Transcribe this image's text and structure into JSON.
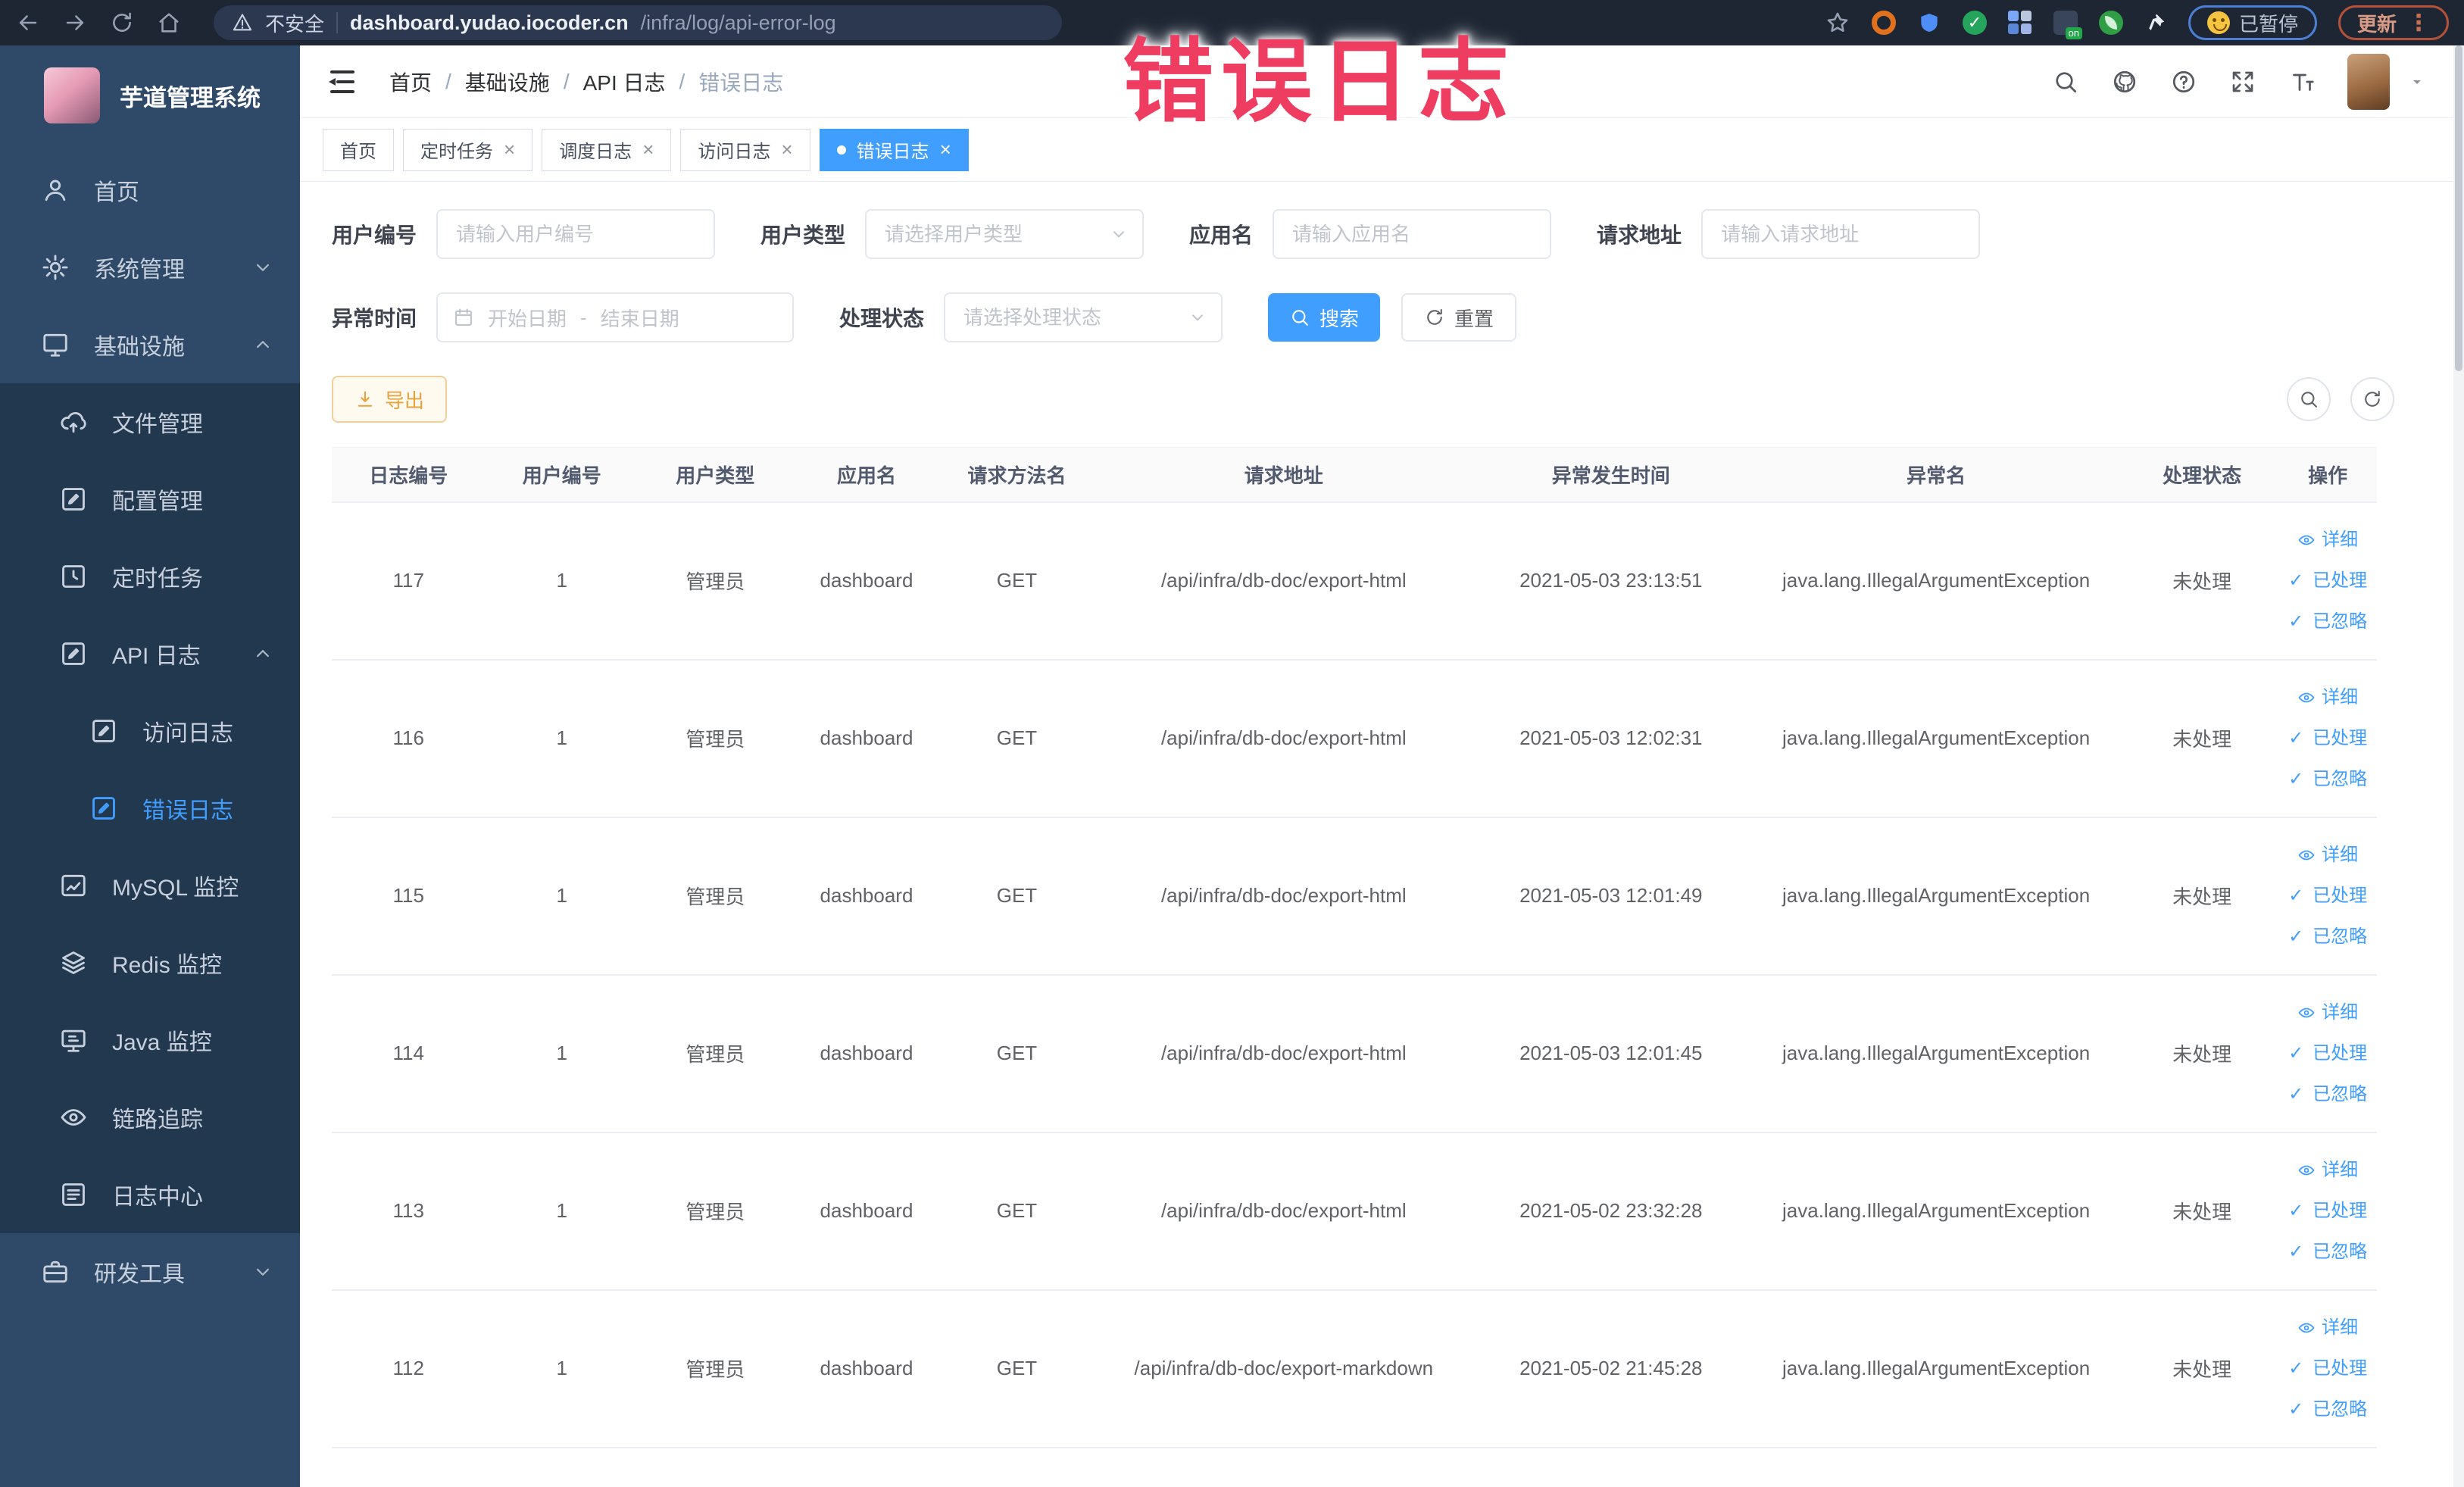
{
  "browser": {
    "security_label": "不安全",
    "url_domain": "dashboard.yudao.iocoder.cn",
    "url_path": "/infra/log/api-error-log",
    "paused_badge": "已暂停",
    "update_button": "更新"
  },
  "annotation": {
    "text": "错误日志",
    "color": "#ee3d60"
  },
  "sidebar": {
    "title": "芋道管理系统",
    "items": [
      {
        "label": "首页",
        "icon": "user-icon",
        "level": 1
      },
      {
        "label": "系统管理",
        "icon": "gear-icon",
        "level": 1,
        "arrow": "down"
      },
      {
        "label": "基础设施",
        "icon": "monitor-icon",
        "level": 1,
        "arrow": "up"
      },
      {
        "label": "文件管理",
        "icon": "cloud-upload-icon",
        "level": 2,
        "dark": true
      },
      {
        "label": "配置管理",
        "icon": "edit-icon",
        "level": 2,
        "dark": true
      },
      {
        "label": "定时任务",
        "icon": "schedule-icon",
        "level": 2,
        "dark": true
      },
      {
        "label": "API 日志",
        "icon": "log-icon",
        "level": 2,
        "dark": true,
        "arrow": "up"
      },
      {
        "label": "访问日志",
        "icon": "log-icon",
        "level": 3,
        "dark": true
      },
      {
        "label": "错误日志",
        "icon": "log-icon",
        "level": 3,
        "dark": true,
        "active": true
      },
      {
        "label": "MySQL 监控",
        "icon": "chart-icon",
        "level": 2,
        "dark": true
      },
      {
        "label": "Redis 监控",
        "icon": "layers-icon",
        "level": 2,
        "dark": true
      },
      {
        "label": "Java 监控",
        "icon": "java-icon",
        "level": 2,
        "dark": true
      },
      {
        "label": "链路追踪",
        "icon": "eye-icon",
        "level": 2,
        "dark": true
      },
      {
        "label": "日志中心",
        "icon": "doc-icon",
        "level": 2,
        "dark": true
      },
      {
        "label": "研发工具",
        "icon": "tools-icon",
        "level": 1,
        "arrow": "down"
      }
    ]
  },
  "breadcrumb": [
    "首页",
    "基础设施",
    "API 日志",
    "错误日志"
  ],
  "tabs": [
    {
      "label": "首页",
      "closable": false,
      "active": false
    },
    {
      "label": "定时任务",
      "closable": true,
      "active": false
    },
    {
      "label": "调度日志",
      "closable": true,
      "active": false
    },
    {
      "label": "访问日志",
      "closable": true,
      "active": false
    },
    {
      "label": "错误日志",
      "closable": true,
      "active": true
    }
  ],
  "filters": {
    "user_id": {
      "label": "用户编号",
      "placeholder": "请输入用户编号"
    },
    "user_type": {
      "label": "用户类型",
      "placeholder": "请选择用户类型"
    },
    "app_name": {
      "label": "应用名",
      "placeholder": "请输入应用名"
    },
    "request_url": {
      "label": "请求地址",
      "placeholder": "请输入请求地址"
    },
    "exception_time": {
      "label": "异常时间",
      "start_placeholder": "开始日期",
      "separator": "-",
      "end_placeholder": "结束日期"
    },
    "process_status": {
      "label": "处理状态",
      "placeholder": "请选择处理状态"
    },
    "search_button": "搜索",
    "reset_button": "重置"
  },
  "toolbar": {
    "export_button": "导出"
  },
  "table": {
    "headers": [
      "日志编号",
      "用户编号",
      "用户类型",
      "应用名",
      "请求方法名",
      "请求地址",
      "异常发生时间",
      "异常名",
      "处理状态",
      "操作"
    ],
    "row_actions": [
      "详细",
      "已处理",
      "已忽略"
    ],
    "rows": [
      {
        "id": "117",
        "user_id": "1",
        "user_type": "管理员",
        "app_name": "dashboard",
        "method": "GET",
        "url": "/api/infra/db-doc/export-html",
        "time": "2021-05-03 23:13:51",
        "exception": "java.lang.IllegalArgumentException",
        "status": "未处理"
      },
      {
        "id": "116",
        "user_id": "1",
        "user_type": "管理员",
        "app_name": "dashboard",
        "method": "GET",
        "url": "/api/infra/db-doc/export-html",
        "time": "2021-05-03 12:02:31",
        "exception": "java.lang.IllegalArgumentException",
        "status": "未处理"
      },
      {
        "id": "115",
        "user_id": "1",
        "user_type": "管理员",
        "app_name": "dashboard",
        "method": "GET",
        "url": "/api/infra/db-doc/export-html",
        "time": "2021-05-03 12:01:49",
        "exception": "java.lang.IllegalArgumentException",
        "status": "未处理"
      },
      {
        "id": "114",
        "user_id": "1",
        "user_type": "管理员",
        "app_name": "dashboard",
        "method": "GET",
        "url": "/api/infra/db-doc/export-html",
        "time": "2021-05-03 12:01:45",
        "exception": "java.lang.IllegalArgumentException",
        "status": "未处理"
      },
      {
        "id": "113",
        "user_id": "1",
        "user_type": "管理员",
        "app_name": "dashboard",
        "method": "GET",
        "url": "/api/infra/db-doc/export-html",
        "time": "2021-05-02 23:32:28",
        "exception": "java.lang.IllegalArgumentException",
        "status": "未处理"
      },
      {
        "id": "112",
        "user_id": "1",
        "user_type": "管理员",
        "app_name": "dashboard",
        "method": "GET",
        "url": "/api/infra/db-doc/export-markdown",
        "time": "2021-05-02 21:45:28",
        "exception": "java.lang.IllegalArgumentException",
        "status": "未处理"
      }
    ]
  }
}
